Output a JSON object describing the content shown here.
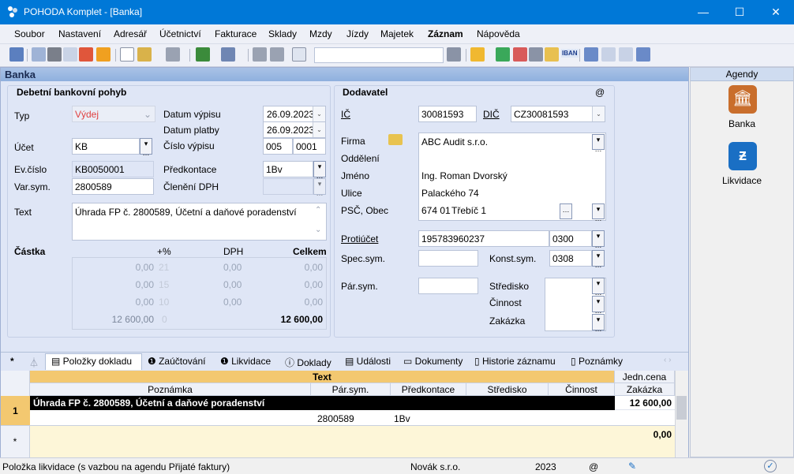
{
  "window": {
    "title": "POHODA Komplet - [Banka]",
    "minimize": "—",
    "maximize": "☐",
    "close": "✕"
  },
  "menu": [
    "Soubor",
    "Nastavení",
    "Adresář",
    "Účetnictví",
    "Fakturace",
    "Sklady",
    "Mzdy",
    "Jízdy",
    "Majetek",
    "Záznam",
    "Nápověda"
  ],
  "toolbar": {
    "combo_value": "",
    "iban": "IBAN"
  },
  "agenda_title": "Banka",
  "debet": {
    "group": "Debetní bankovní pohyb",
    "typ_label": "Typ",
    "typ_value": "Výdej",
    "ucet_label": "Účet",
    "ucet_value": "KB",
    "evcislo_label": "Ev.číslo",
    "evcislo_value": "KB0050001",
    "varsym_label": "Var.sym.",
    "varsym_value": "2800589",
    "text_label": "Text",
    "text_value": "Úhrada FP č. 2800589, Účetní a daňové poradenství",
    "datum_vypisu_label": "Datum výpisu",
    "datum_vypisu": "26.09.2023",
    "datum_platby_label": "Datum platby",
    "datum_platby": "26.09.2023",
    "cislo_vypisu_label": "Číslo výpisu",
    "cislo_vypisu_a": "005",
    "cislo_vypisu_b": "0001",
    "predkontace_label": "Předkontace",
    "predkontace_value": "1Bv",
    "cleneni_label": "Členění DPH",
    "cleneni_value": ""
  },
  "castka": {
    "label": "Částka",
    "h_pct": "+%",
    "h_dph": "DPH",
    "h_celkem": "Celkem",
    "rows": [
      {
        "base": "0,00",
        "pct": "21",
        "dph": "0,00",
        "total": "0,00"
      },
      {
        "base": "0,00",
        "pct": "15",
        "dph": "0,00",
        "total": "0,00"
      },
      {
        "base": "0,00",
        "pct": "10",
        "dph": "0,00",
        "total": "0,00"
      },
      {
        "base": "12 600,00",
        "pct": "0",
        "dph": "",
        "total": "12 600,00"
      }
    ]
  },
  "dodavatel": {
    "group": "Dodavatel",
    "at": "@",
    "ic_label": "IČ",
    "ic_value": "30081593",
    "dic_label": "DIČ",
    "dic_value": "CZ30081593",
    "firma_label": "Firma",
    "firma_value": "ABC Audit s.r.o.",
    "oddeleni_label": "Oddělení",
    "oddeleni_value": "",
    "jmeno_label": "Jméno",
    "jmeno_value": "Ing. Roman Dvorský",
    "ulice_label": "Ulice",
    "ulice_value": "Palackého 74",
    "psc_label": "PSČ, Obec",
    "psc_value": "674 01",
    "obec_value": "Třebíč 1",
    "protiucet_label": "Protiúčet",
    "protiucet_value": "195783960237",
    "banka_kod": "0300",
    "specsym_label": "Spec.sym.",
    "specsym_value": "",
    "konstsym_label": "Konst.sym.",
    "konstsym_value": "0308",
    "parsym_label": "Pár.sym.",
    "parsym_value": "",
    "stredisko_label": "Středisko",
    "cinnost_label": "Činnost",
    "zakazka_label": "Zakázka"
  },
  "agendy": {
    "title": "Agendy",
    "items": [
      {
        "label": "Banka"
      },
      {
        "label": "Likvidace"
      }
    ]
  },
  "tabs": [
    "*",
    "Položky dokladu",
    "Zaúčtování",
    "Likvidace",
    "Doklady",
    "Události",
    "Dokumenty",
    "Historie záznamu",
    "Poznámky"
  ],
  "grid": {
    "h_text": "Text",
    "h_poznamka": "Poznámka",
    "h_parsym": "Pár.sym.",
    "h_predkontace": "Předkontace",
    "h_stredisko": "Středisko",
    "h_cinnost": "Činnost",
    "h_jednc": "Jedn.cena",
    "h_zakazka": "Zakázka",
    "row1": {
      "num": "1",
      "text": "Úhrada FP č. 2800589, Účetní a daňové poradenství",
      "price": "12 600,00",
      "parsym": "2800589",
      "predkontace": "1Bv"
    },
    "new_row": {
      "marker": "*",
      "total": "0,00"
    }
  },
  "status": {
    "message": "Položka likvidace (s vazbou na agendu Přijaté faktury)",
    "user": "Novák  s.r.o.",
    "year": "2023",
    "at": "@"
  }
}
